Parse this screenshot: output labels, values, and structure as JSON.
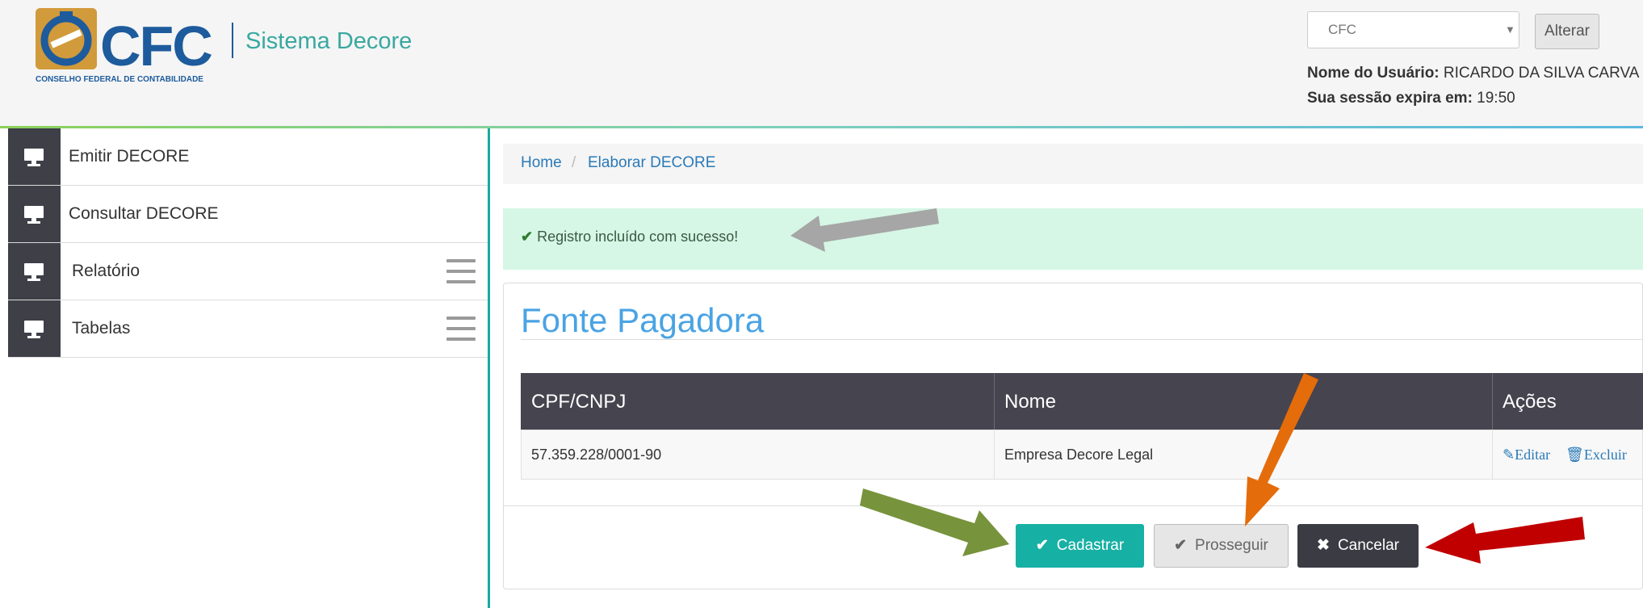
{
  "header": {
    "logo_text": "CFC",
    "logo_subtitle": "CONSELHO FEDERAL DE CONTABILIDADE",
    "app_title": "Sistema Decore",
    "profile_select_value": "CFC",
    "alterar_label": "Alterar",
    "user_label": "Nome do Usuário:",
    "user_name": "RICARDO DA SILVA CARVA",
    "session_label": "Sua sessão expira em:",
    "session_time": "19:50"
  },
  "sidebar": {
    "items": [
      {
        "label": "Emitir DECORE",
        "icon": "monitor-icon",
        "has_menu": false
      },
      {
        "label": "Consultar DECORE",
        "icon": "monitor-icon",
        "has_menu": false
      },
      {
        "label": "Relatório",
        "icon": "monitor-icon",
        "has_menu": true
      },
      {
        "label": "Tabelas",
        "icon": "monitor-icon",
        "has_menu": true
      }
    ]
  },
  "breadcrumb": {
    "items": [
      "Home",
      "Elaborar DECORE"
    ],
    "separator": "/"
  },
  "alert": {
    "message": "Registro incluído com sucesso!",
    "icon": "check-icon"
  },
  "panel": {
    "title": "Fonte Pagadora",
    "columns": [
      "CPF/CNPJ",
      "Nome",
      "Ações"
    ],
    "rows": [
      {
        "cpf_cnpj": "57.359.228/0001-90",
        "nome": "Empresa Decore Legal",
        "actions": [
          "Editar",
          "Excluir"
        ]
      }
    ],
    "buttons": {
      "cadastrar": "Cadastrar",
      "prosseguir": "Prosseguir",
      "cancelar": "Cancelar"
    }
  },
  "annotations": {
    "arrow_colors": {
      "gray": "#a6a6a6",
      "green": "#77933c",
      "orange": "#e46c0a",
      "red": "#c00000"
    }
  },
  "colors": {
    "brand_blue": "#1d5b9c",
    "brand_gold": "#d19a3a",
    "teal": "#17b0a4",
    "link_blue": "#2a7ab7",
    "table_header": "#46444f",
    "alert_bg": "#d6f7e6"
  }
}
